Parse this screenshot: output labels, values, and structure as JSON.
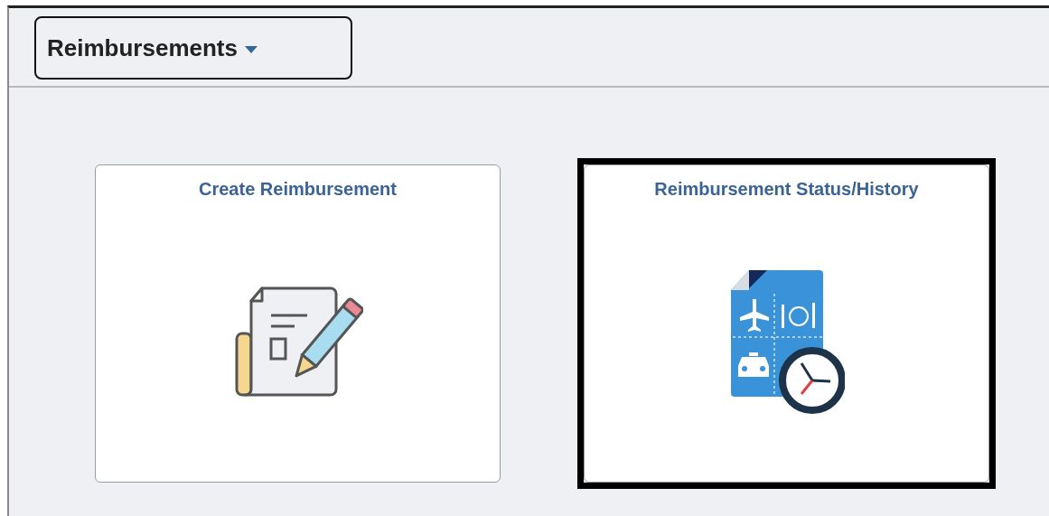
{
  "menu_button": {
    "label": "Reimbursements"
  },
  "tiles": [
    {
      "title": "Create Reimbursement",
      "kind": "create",
      "highlighted": false
    },
    {
      "title": "Reimbursement Status/History",
      "kind": "status",
      "highlighted": true
    }
  ]
}
